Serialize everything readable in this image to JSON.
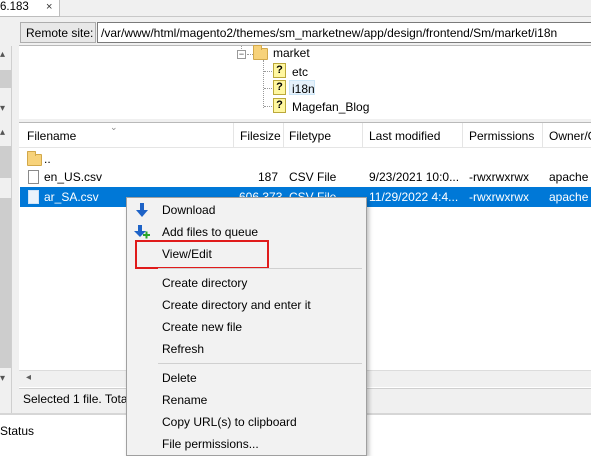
{
  "tab": {
    "label": "6.183",
    "close": "×"
  },
  "remote_site": {
    "label": "Remote site:",
    "path": "/var/www/html/magento2/themes/sm_marketnew/app/design/frontend/Sm/market/i18n"
  },
  "tree": {
    "items": [
      {
        "label": "market",
        "icon": "folder-icon"
      },
      {
        "label": "etc",
        "icon": "unknown-folder-icon"
      },
      {
        "label": "i18n",
        "icon": "unknown-folder-icon"
      },
      {
        "label": "Magefan_Blog",
        "icon": "unknown-folder-icon"
      }
    ]
  },
  "file_list": {
    "columns": [
      "Filename",
      "Filesize",
      "Filetype",
      "Last modified",
      "Permissions",
      "Owner/G"
    ],
    "rows": [
      {
        "name": "..",
        "size": "",
        "type": "",
        "modified": "",
        "permissions": "",
        "owner": ""
      },
      {
        "name": "en_US.csv",
        "size": "187",
        "type": "CSV File",
        "modified": "9/23/2021 10:0...",
        "permissions": "-rwxrwxrwx",
        "owner": "apache"
      },
      {
        "name": "ar_SA.csv",
        "size": "606,373",
        "type": "CSV File",
        "modified": "11/29/2022 4:4...",
        "permissions": "-rwxrwxrwx",
        "owner": "apache"
      }
    ]
  },
  "status_line": "Selected 1 file. Total",
  "bottom": {
    "title": "Status"
  },
  "context_menu": {
    "items": [
      {
        "label": "Download",
        "icon": "download-arrow-icon"
      },
      {
        "label": "Add files to queue",
        "icon": "add-to-queue-icon"
      },
      {
        "label": "View/Edit",
        "icon": ""
      },
      {
        "label": "Create directory",
        "icon": ""
      },
      {
        "label": "Create directory and enter it",
        "icon": ""
      },
      {
        "label": "Create new file",
        "icon": ""
      },
      {
        "label": "Refresh",
        "icon": ""
      },
      {
        "label": "Delete",
        "icon": ""
      },
      {
        "label": "Rename",
        "icon": ""
      },
      {
        "label": "Copy URL(s) to clipboard",
        "icon": ""
      },
      {
        "label": "File permissions...",
        "icon": ""
      }
    ]
  },
  "colors": {
    "selection": "#0078d7",
    "highlight_box": "#e01b1b",
    "menu_bg": "#f2f2f2"
  }
}
